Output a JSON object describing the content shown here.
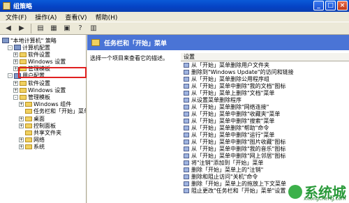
{
  "window": {
    "title": "组策略"
  },
  "menu": [
    "文件(F)",
    "操作(A)",
    "查看(V)",
    "帮助(H)"
  ],
  "tree": {
    "root": "\"本地计算机\" 策略",
    "items": [
      {
        "label": "计算机配置",
        "indent": 1,
        "expander": "-",
        "icon": "computer"
      },
      {
        "label": "软件设置",
        "indent": 2,
        "expander": "+",
        "icon": "folder"
      },
      {
        "label": "Windows 设置",
        "indent": 2,
        "expander": "+",
        "icon": "folder"
      },
      {
        "label": "管理模板",
        "indent": 2,
        "expander": "+",
        "icon": "folder"
      },
      {
        "label": "用户配置",
        "indent": 1,
        "expander": "-",
        "icon": "user"
      },
      {
        "label": "软件设置",
        "indent": 2,
        "expander": "+",
        "icon": "folder"
      },
      {
        "label": "Windows 设置",
        "indent": 2,
        "expander": "+",
        "icon": "folder"
      },
      {
        "label": "管理模板",
        "indent": 2,
        "expander": "-",
        "icon": "folder"
      },
      {
        "label": "Windows 组件",
        "indent": 3,
        "expander": "+",
        "icon": "folder"
      },
      {
        "label": "任务栏和「开始」菜单",
        "indent": 3,
        "expander": "",
        "icon": "folder"
      },
      {
        "label": "桌面",
        "indent": 3,
        "expander": "+",
        "icon": "folder"
      },
      {
        "label": "控制面板",
        "indent": 3,
        "expander": "+",
        "icon": "folder"
      },
      {
        "label": "共享文件夹",
        "indent": 3,
        "expander": "",
        "icon": "folder"
      },
      {
        "label": "网络",
        "indent": 3,
        "expander": "+",
        "icon": "folder"
      },
      {
        "label": "系统",
        "indent": 3,
        "expander": "+",
        "icon": "folder"
      }
    ]
  },
  "right": {
    "header": "任务栏和「开始」菜单",
    "description": "选择一个项目来查看它的描述。",
    "column": "设置",
    "settings": [
      "从「开始」菜单删除用户文件夹",
      "删除到\"Windows Update\"的访问和链接",
      "从「开始」菜单删除公用程序组",
      "从「开始」菜单中删除\"我的文档\"图标",
      "从「开始」菜单上删除\"文档\"菜单",
      "从设置菜单删除程序",
      "从「开始」菜单删除\"网络连接\"",
      "从「开始」菜单中删除\"收藏夹\"菜单",
      "从「开始」菜单中删除\"搜索\"菜单",
      "从「开始」菜单删除\"帮助\"命令",
      "从「开始」菜单中删除\"运行\"菜单",
      "从「开始」菜单中删除\"图片收藏\"图标",
      "从「开始」菜单中删除\"我的音乐\"图标",
      "从「开始」菜单中删除\"网上邻居\"图标",
      "将\"注销\"添加到「开始」菜单",
      "删除「开始」菜单上的\"注销\"",
      "删除和阻止访问\"关机\"命令",
      "删除「开始」菜单上的拖放上下文菜单",
      "阻止更改\"任务栏和「开始」菜单\"设置"
    ]
  },
  "watermark": {
    "text": "系统城",
    "sub": "xitongcheng.com"
  }
}
